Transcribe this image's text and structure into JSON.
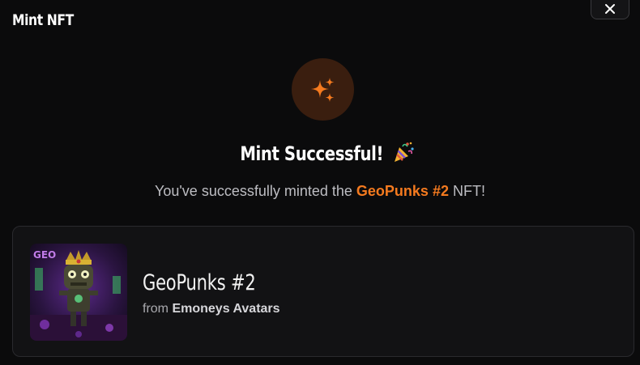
{
  "modal": {
    "title": "Mint NFT",
    "close_icon": "close-icon"
  },
  "success": {
    "icon": "sparkles-icon",
    "heading": "Mint Successful!",
    "emoji_icon": "party-popper-icon",
    "message_prefix": "You've successfully minted the",
    "nft_name": "GeoPunks #2",
    "message_suffix": "NFT!"
  },
  "nft_card": {
    "name": "GeoPunks #2",
    "from_label": "from",
    "collection": "Emoneys Avatars",
    "image_icon": "nft-artwork-image"
  },
  "colors": {
    "accent": "#f47a1f",
    "icon_bg": "#3a1e0f",
    "background": "#0b0b0c",
    "card_bg": "#121214"
  }
}
